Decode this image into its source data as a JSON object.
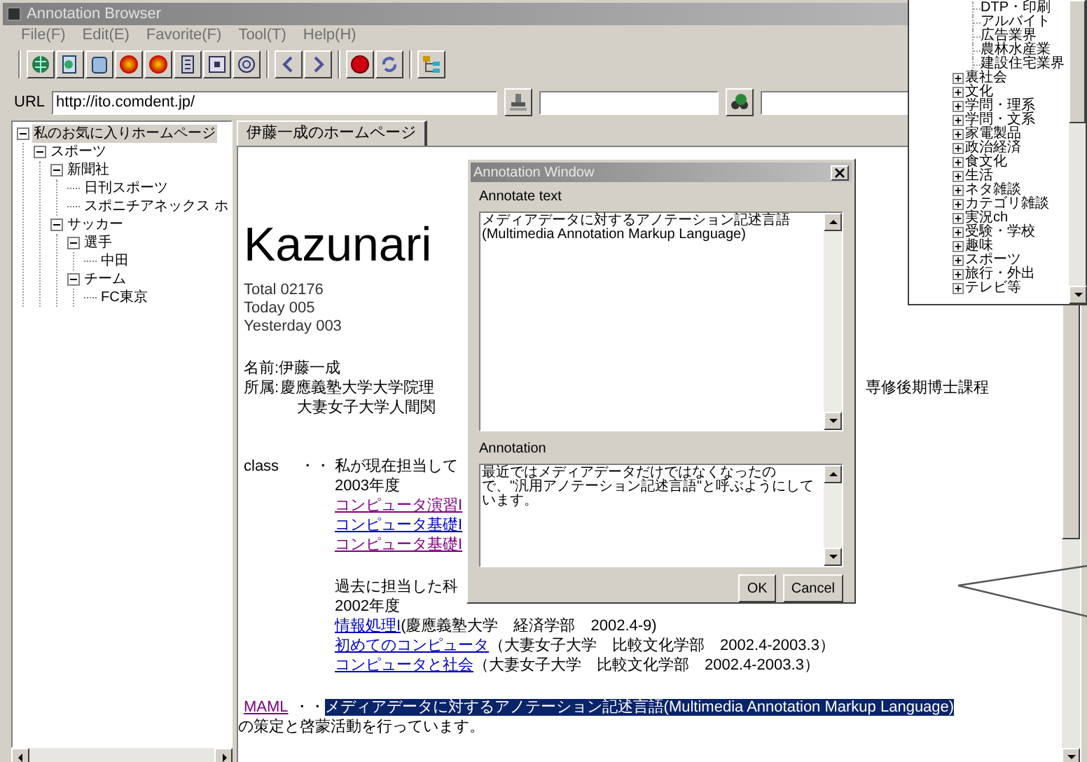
{
  "window": {
    "title": "Annotation Browser"
  },
  "menu": [
    "File(F)",
    "Edit(E)",
    "Favorite(F)",
    "Tool(T)",
    "Help(H)"
  ],
  "url_bar": {
    "label": "URL",
    "value": "http://ito.comdent.jp/"
  },
  "favorites_tree": [
    {
      "label": "私のお気に入りホームページ",
      "selected": true,
      "expanded": true,
      "children": [
        {
          "label": "スポーツ",
          "selected": false,
          "expanded": true,
          "children": [
            {
              "label": "新聞社",
              "selected": false,
              "expanded": true,
              "children": [
                {
                  "label": "日刊スポーツ",
                  "selected": false
                },
                {
                  "label": "スポニチアネックス ホ",
                  "selected": false
                }
              ]
            },
            {
              "label": "サッカー",
              "selected": false,
              "expanded": true,
              "children": [
                {
                  "label": "選手",
                  "selected": false,
                  "expanded": true,
                  "children": [
                    {
                      "label": "中田",
                      "selected": false
                    }
                  ]
                },
                {
                  "label": "チーム",
                  "selected": false,
                  "expanded": true,
                  "children": [
                    {
                      "label": "FC東京",
                      "selected": false
                    }
                  ]
                }
              ]
            }
          ]
        }
      ]
    }
  ],
  "tabs": [
    {
      "label": "伊藤一成のホームページ",
      "selected": true
    }
  ],
  "page": {
    "heading": "Kazunari",
    "counters": [
      "Total 02176",
      "Today 005",
      "Yesterday 003"
    ],
    "name_line": "名前:伊藤一成",
    "affiliation": {
      "label": "所属:",
      "line_1_parts": [
        "慶應義塾大学大学院理",
        "専修後期博士課程"
      ],
      "line_2": "大妻女子大学人間関"
    },
    "class_section": {
      "label": "class",
      "separator": "・・",
      "intro": "私が現在担当して",
      "current_year": "2003年度",
      "current_links": [
        {
          "text": "コンピュータ演習I",
          "visited": true
        },
        {
          "text": "コンピュータ基礎I",
          "visited": false
        },
        {
          "text": "コンピュータ基礎I",
          "visited": true
        }
      ],
      "past_intro": "過去に担当した科",
      "past_year": "2002年度",
      "past_courses": [
        {
          "link": "情報処理I",
          "visited": false,
          "detail": "(慶應義塾大学　経済学部　2002.4-9)"
        },
        {
          "link": "初めてのコンピュータ",
          "visited": false,
          "detail": "（大妻女子大学　比較文化学部　2002.4-2003.3）"
        },
        {
          "link": "コンピュータと社会",
          "visited": false,
          "detail": "（大妻女子大学　比較文化学部　2002.4-2003.3）"
        }
      ]
    },
    "maml": {
      "link": "MAML",
      "visited": true,
      "separator": "・・",
      "parts": [
        {
          "text": "メディアデータに対するアノテーション記述言語(Multimedia Annotation Markup Language)",
          "highlighted": true
        },
        {
          "text": "の策定と啓蒙活動を行っています。",
          "highlighted": false
        }
      ]
    }
  },
  "annotation_window": {
    "title": "Annotation Window",
    "annotate_label": "Annotate text",
    "annotate_value": "メディアデータに対するアノテーション記述言語(Multimedia Annotation Markup Language)",
    "annotation_label": "Annotation",
    "annotation_value": "最近ではメディアデータだけではなくなったので、\"汎用アノテーション記述言語\"と呼ぶようにしています。",
    "buttons": [
      "OK",
      "Cancel"
    ]
  },
  "category_tree": [
    {
      "label": "DTP・印刷",
      "kind": "leaf"
    },
    {
      "label": "アルバイト",
      "kind": "leaf"
    },
    {
      "label": "広告業界",
      "kind": "leaf"
    },
    {
      "label": "農林水産業",
      "kind": "leaf"
    },
    {
      "label": "建設住宅業界",
      "kind": "leaf"
    },
    {
      "label": "裏社会",
      "kind": "folder",
      "expanded": false
    },
    {
      "label": "文化",
      "kind": "folder",
      "expanded": false
    },
    {
      "label": "学問・理系",
      "kind": "folder",
      "expanded": false
    },
    {
      "label": "学問・文系",
      "kind": "folder",
      "expanded": false
    },
    {
      "label": "家電製品",
      "kind": "folder",
      "expanded": false
    },
    {
      "label": "政治経済",
      "kind": "folder",
      "expanded": false
    },
    {
      "label": "食文化",
      "kind": "folder",
      "expanded": false
    },
    {
      "label": "生活",
      "kind": "folder",
      "expanded": false
    },
    {
      "label": "ネタ雑談",
      "kind": "folder",
      "expanded": false
    },
    {
      "label": "カテゴリ雑談",
      "kind": "folder",
      "expanded": false
    },
    {
      "label": "実況ch",
      "kind": "folder",
      "expanded": false
    },
    {
      "label": "受験・学校",
      "kind": "folder",
      "expanded": false
    },
    {
      "label": "趣味",
      "kind": "folder",
      "expanded": false
    },
    {
      "label": "スポーツ",
      "kind": "folder",
      "expanded": false
    },
    {
      "label": "旅行・外出",
      "kind": "folder",
      "expanded": false
    },
    {
      "label": "テレビ等",
      "kind": "folder",
      "expanded": false
    }
  ]
}
